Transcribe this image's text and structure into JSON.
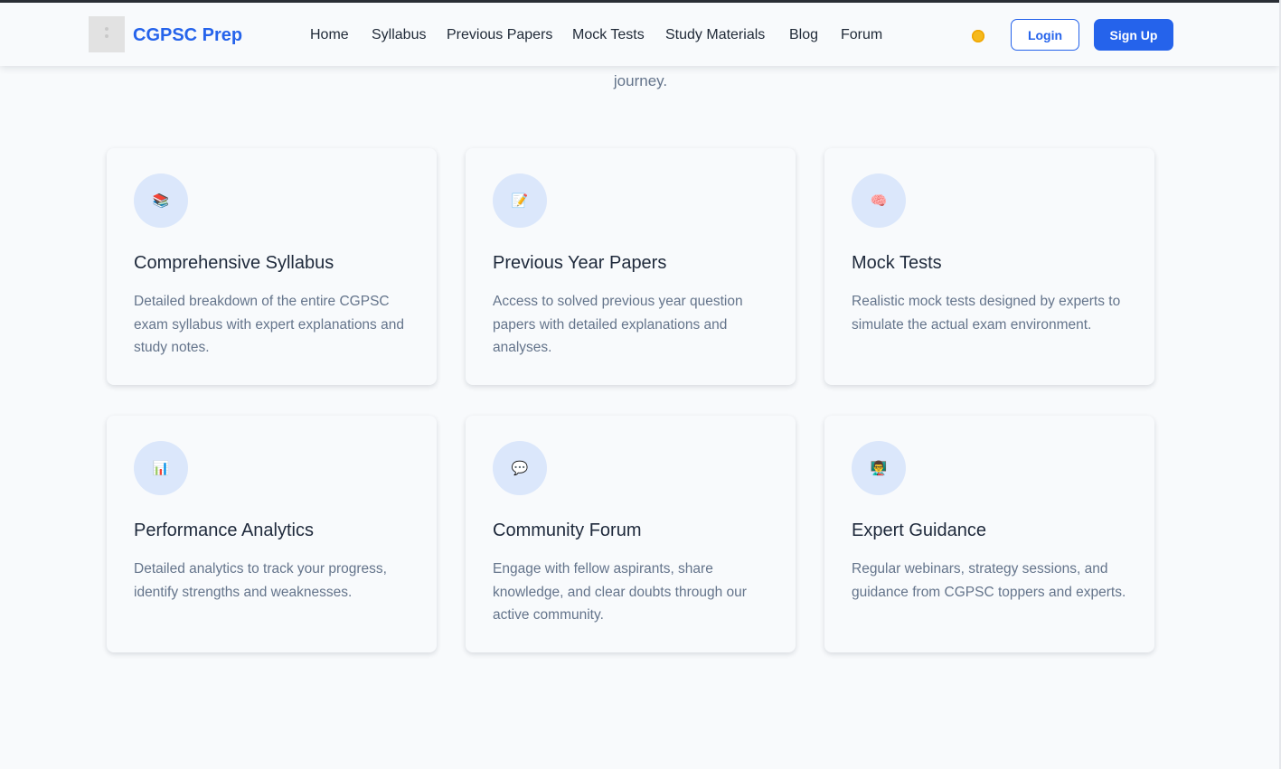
{
  "brand": {
    "name": "CGPSC Prep"
  },
  "nav": {
    "links": [
      "Home",
      "Syllabus",
      "Previous Papers",
      "Mock Tests",
      "Study Materials",
      "Blog",
      "Forum"
    ],
    "login": "Login",
    "signup": "Sign Up"
  },
  "hero": {
    "tail_text": "journey."
  },
  "features": [
    {
      "icon": "📚",
      "title": "Comprehensive Syllabus",
      "desc": "Detailed breakdown of the entire CGPSC exam syllabus with expert explanations and study notes."
    },
    {
      "icon": "📝",
      "title": "Previous Year Papers",
      "desc": "Access to solved previous year question papers with detailed explanations and analyses."
    },
    {
      "icon": "🧠",
      "title": "Mock Tests",
      "desc": "Realistic mock tests designed by experts to simulate the actual exam environment."
    },
    {
      "icon": "📊",
      "title": "Performance Analytics",
      "desc": "Detailed analytics to track your progress, identify strengths and weaknesses."
    },
    {
      "icon": "💬",
      "title": "Community Forum",
      "desc": "Engage with fellow aspirants, share knowledge, and clear doubts through our active community."
    },
    {
      "icon": "👨‍🏫",
      "title": "Expert Guidance",
      "desc": "Regular webinars, strategy sessions, and guidance from CGPSC toppers and experts."
    }
  ],
  "colors": {
    "accent": "#2563eb",
    "background": "#f8fafc",
    "icon_bg": "#dbe7fb",
    "text_muted": "#64748b"
  }
}
